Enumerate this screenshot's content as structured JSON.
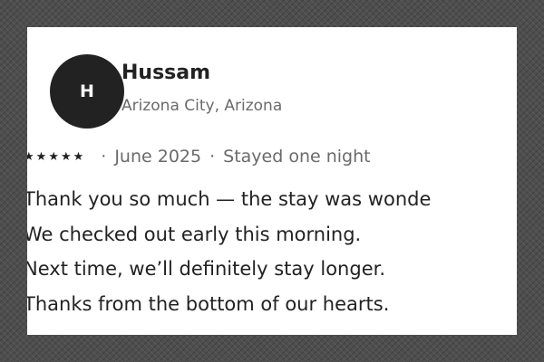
{
  "review": {
    "avatar_initial": "H",
    "reviewer_name": "Hussam",
    "reviewer_location": "Arizona City, Arizona",
    "rating": 5,
    "star_icon": "star-icon",
    "separator": "·",
    "date": "June 2025",
    "stay_info": "Stayed one night",
    "text_lines": [
      "Thank you so much — the stay was wonde",
      "We checked out early this morning.",
      "Next time, we’ll definitely stay longer.",
      "Thanks from the bottom of our hearts."
    ]
  },
  "colors": {
    "avatar_background": "#222222",
    "avatar_text": "#ffffff",
    "primary_text": "#222222",
    "secondary_text": "#6a6a6a",
    "card_background": "#ffffff",
    "page_background": "#4e4e4e"
  }
}
